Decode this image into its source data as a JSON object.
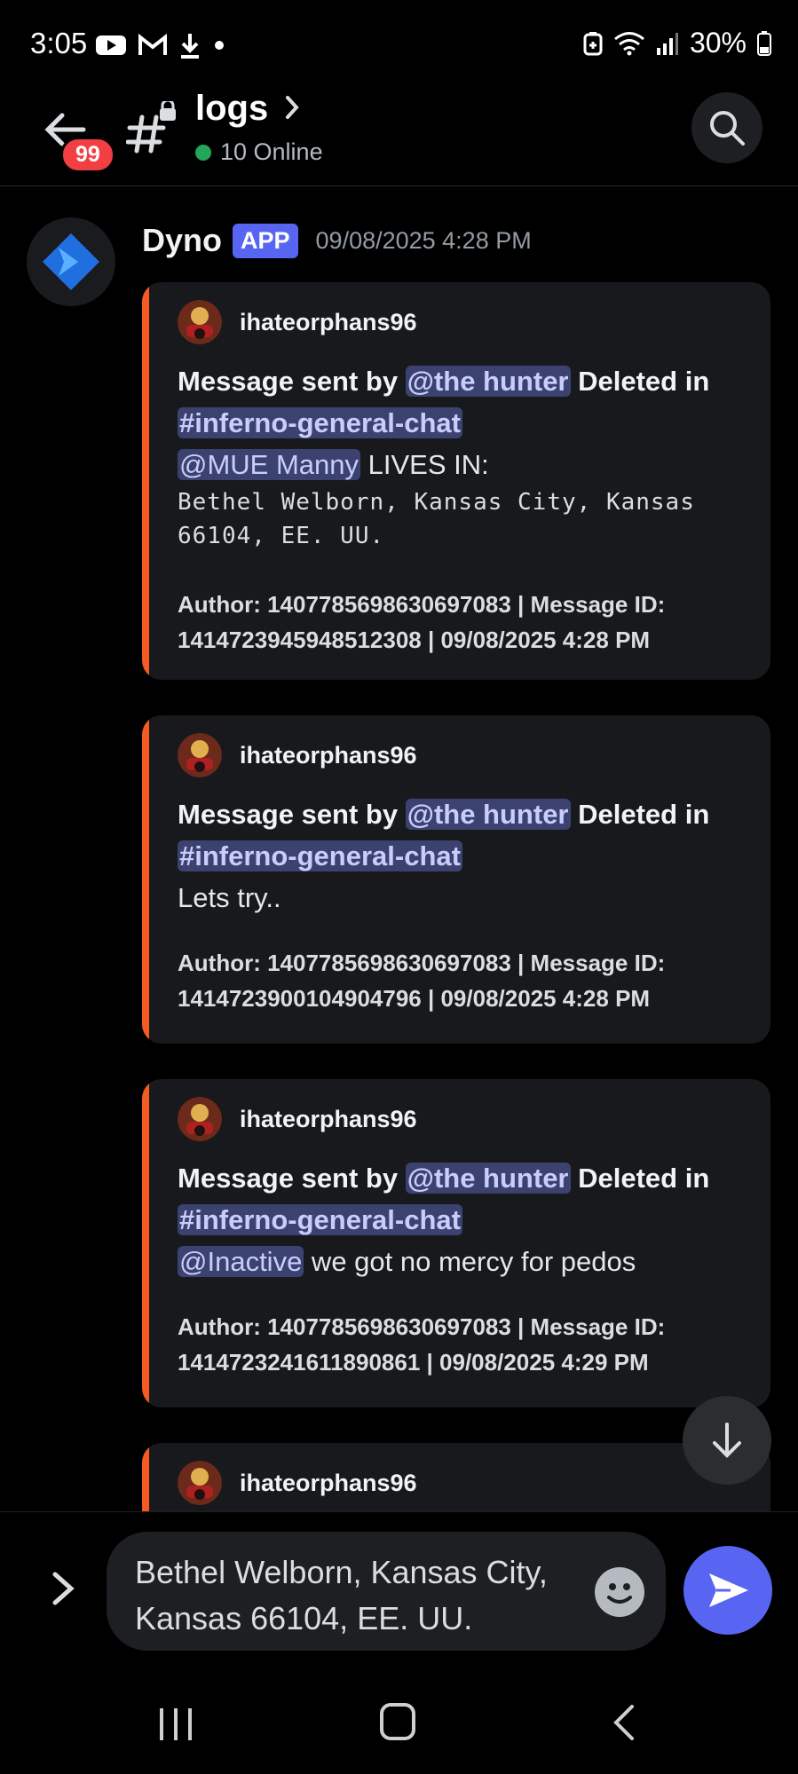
{
  "status_bar": {
    "time": "3:05",
    "battery": "30%",
    "icons_left": [
      "youtube-icon",
      "gmail-icon",
      "download-icon",
      "dot-icon"
    ],
    "icons_right": [
      "battery-saver-icon",
      "wifi-icon",
      "signal-icon",
      "battery-icon"
    ]
  },
  "header": {
    "channel_name": "logs",
    "online_text": "10 Online",
    "unread_badge": "99"
  },
  "message": {
    "author": "Dyno",
    "tag": "APP",
    "timestamp": "09/08/2025 4:28 PM",
    "embeds": [
      {
        "author_name": "ihateorphans96",
        "prefix": "Message sent by ",
        "user_mention": "@the hunter",
        "mid": " Deleted in",
        "channel_mention": "#inferno-general-chat",
        "content_mention": "@MUE Manny",
        "content_text": " LIVES IN:",
        "code_text": "Bethel Welborn, Kansas City, Kansas 66104, EE. UU.",
        "footer_line1": "Author: 1407785698630697083 | Message ID:",
        "footer_line2": "1414723945948512308 | 09/08/2025 4:28 PM"
      },
      {
        "author_name": "ihateorphans96",
        "prefix": "Message sent by ",
        "user_mention": "@the hunter",
        "mid": " Deleted in",
        "channel_mention": "#inferno-general-chat",
        "content_text": "Lets try..",
        "footer_line1": "Author: 1407785698630697083 | Message ID:",
        "footer_line2": "1414723900104904796 | 09/08/2025 4:28 PM"
      },
      {
        "author_name": "ihateorphans96",
        "prefix": "Message sent by ",
        "user_mention": "@the hunter",
        "mid": " Deleted in",
        "channel_mention": "#inferno-general-chat",
        "content_mention": "@Inactive",
        "content_text": " we got no mercy for pedos",
        "footer_line1": "Author: 1407785698630697083 | Message ID:",
        "footer_line2": "1414723241611890861 | 09/08/2025 4:29 PM"
      },
      {
        "author_name": "ihateorphans96"
      }
    ]
  },
  "composer": {
    "text": "Bethel Welborn, Kansas City, Kansas 66104, EE. UU."
  },
  "colors": {
    "accent": "#5865f2",
    "embed_bar": "#f35b22",
    "online": "#23a55a",
    "badge": "#f23f43"
  }
}
